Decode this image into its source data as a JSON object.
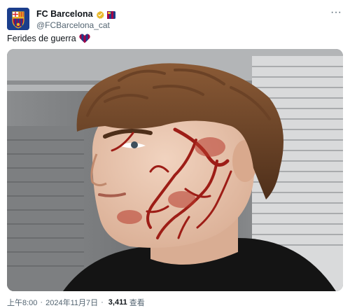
{
  "account": {
    "display_name": "FC Barcelona",
    "handle": "@FCBarcelona_cat"
  },
  "icons": {
    "avatar": "fc-barcelona-crest-icon",
    "verified": "verified-badge-icon",
    "badge": "barcelona-flag-icon",
    "more": "more-options-icon",
    "emoji": "blaugrana-heart-icon"
  },
  "menu": {
    "more_label": "···"
  },
  "tweet": {
    "text": "Ferides de guerra"
  },
  "media": {
    "alt": "photo"
  },
  "meta": {
    "time": "上午8:00",
    "separator": "·",
    "date": "2024年11月7日",
    "views_count": "3,411",
    "views_label": "查看"
  },
  "colors": {
    "verified_gold": "#e8b829",
    "barca_blue": "#1b3e8c",
    "barca_red": "#a50044",
    "text_secondary": "#536471"
  }
}
